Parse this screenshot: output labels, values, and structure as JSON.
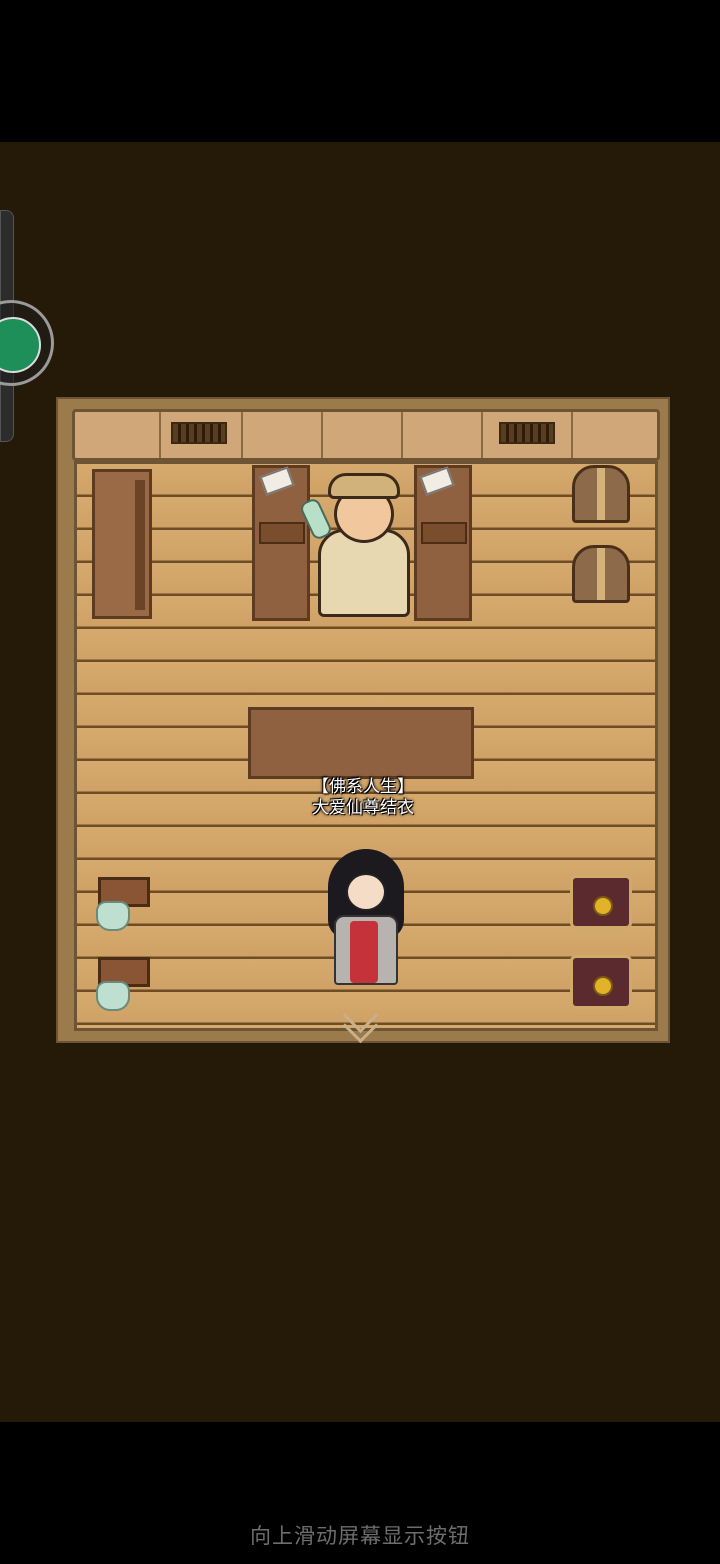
{
  "player": {
    "title": "【佛系人生】",
    "name": "大爱仙尊结衣"
  },
  "system": {
    "swipe_hint": "向上滑动屏幕显示按钮"
  },
  "icons": {
    "floating_ball": "floating-assistant-icon",
    "exit": "chevron-down-icon"
  },
  "colors": {
    "background": "#241a07",
    "floor": "#d6aa6e",
    "wall": "#cfa779"
  }
}
